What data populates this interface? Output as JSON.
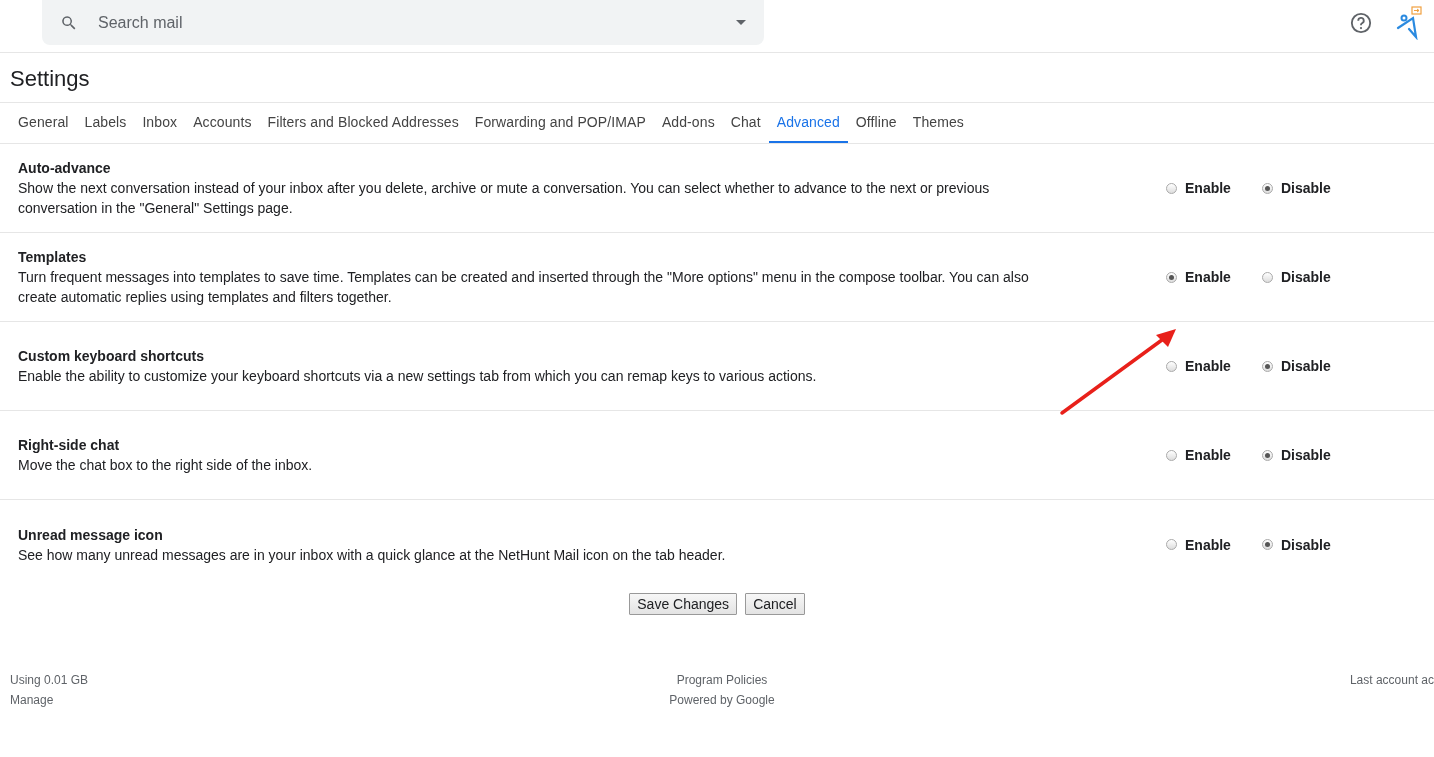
{
  "search": {
    "placeholder": "Search mail"
  },
  "page_title": "Settings",
  "tabs": [
    {
      "label": "General",
      "selected": false
    },
    {
      "label": "Labels",
      "selected": false
    },
    {
      "label": "Inbox",
      "selected": false
    },
    {
      "label": "Accounts",
      "selected": false
    },
    {
      "label": "Filters and Blocked Addresses",
      "selected": false
    },
    {
      "label": "Forwarding and POP/IMAP",
      "selected": false
    },
    {
      "label": "Add-ons",
      "selected": false
    },
    {
      "label": "Chat",
      "selected": false
    },
    {
      "label": "Advanced",
      "selected": true
    },
    {
      "label": "Offline",
      "selected": false
    },
    {
      "label": "Themes",
      "selected": false
    }
  ],
  "settings": [
    {
      "title": "Auto-advance",
      "description": "Show the next conversation instead of your inbox after you delete, archive or mute a conversation. You can select whether to advance to the next or previous conversation in the \"General\" Settings page.",
      "options": [
        {
          "label": "Enable",
          "selected": false
        },
        {
          "label": "Disable",
          "selected": true
        }
      ]
    },
    {
      "title": "Templates",
      "description": "Turn frequent messages into templates to save time. Templates can be created and inserted through the \"More options\" menu in the compose toolbar. You can also create automatic replies using templates and filters together.",
      "options": [
        {
          "label": "Enable",
          "selected": true
        },
        {
          "label": "Disable",
          "selected": false
        }
      ]
    },
    {
      "title": "Custom keyboard shortcuts",
      "description": "Enable the ability to customize your keyboard shortcuts via a new settings tab from which you can remap keys to various actions.",
      "options": [
        {
          "label": "Enable",
          "selected": false
        },
        {
          "label": "Disable",
          "selected": true
        }
      ]
    },
    {
      "title": "Right-side chat",
      "description": "Move the chat box to the right side of the inbox.",
      "options": [
        {
          "label": "Enable",
          "selected": false
        },
        {
          "label": "Disable",
          "selected": true
        }
      ]
    },
    {
      "title": "Unread message icon",
      "description": "See how many unread messages are in your inbox with a quick glance at the NetHunt Mail icon on the tab header.",
      "options": [
        {
          "label": "Enable",
          "selected": false
        },
        {
          "label": "Disable",
          "selected": true
        }
      ]
    }
  ],
  "buttons": [
    "Save Changes",
    "Cancel"
  ],
  "footer": {
    "storage": "Using 0.01 GB",
    "manage": "Manage",
    "policies": "Program Policies",
    "powered": "Powered by Google",
    "last_activity": "Last account ac"
  }
}
